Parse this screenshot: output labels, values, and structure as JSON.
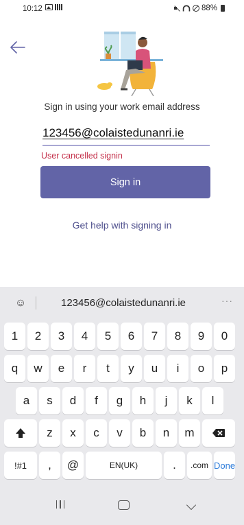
{
  "status_bar": {
    "time": "10:12",
    "battery": "88%",
    "left_icons": [
      "image-notification-icon",
      "grid-notification-icon"
    ],
    "right_icons": [
      "mute-icon",
      "wifi-icon",
      "blocked-icon",
      "battery-icon"
    ]
  },
  "signin": {
    "prompt": "Sign in using your work email address",
    "email_value": "123456@colaistedunanri.ie",
    "error": "User cancelled signin",
    "button_label": "Sign in",
    "help_link": "Get help with signing in",
    "accent_color": "#6264a7",
    "error_color": "#c4314b"
  },
  "keyboard": {
    "suggestion": "123456@colaistedunanri.ie",
    "more": "···",
    "rows": [
      [
        "1",
        "2",
        "3",
        "4",
        "5",
        "6",
        "7",
        "8",
        "9",
        "0"
      ],
      [
        "q",
        "w",
        "e",
        "r",
        "t",
        "y",
        "u",
        "i",
        "o",
        "p"
      ],
      [
        "a",
        "s",
        "d",
        "f",
        "g",
        "h",
        "j",
        "k",
        "l"
      ],
      [
        "z",
        "x",
        "c",
        "v",
        "b",
        "n",
        "m"
      ]
    ],
    "bottom": {
      "symbols": "!#1",
      "comma": ",",
      "at": "@",
      "space": "EN(UK)",
      "period": ".",
      "dotcom": ".com",
      "done": "Done"
    }
  }
}
